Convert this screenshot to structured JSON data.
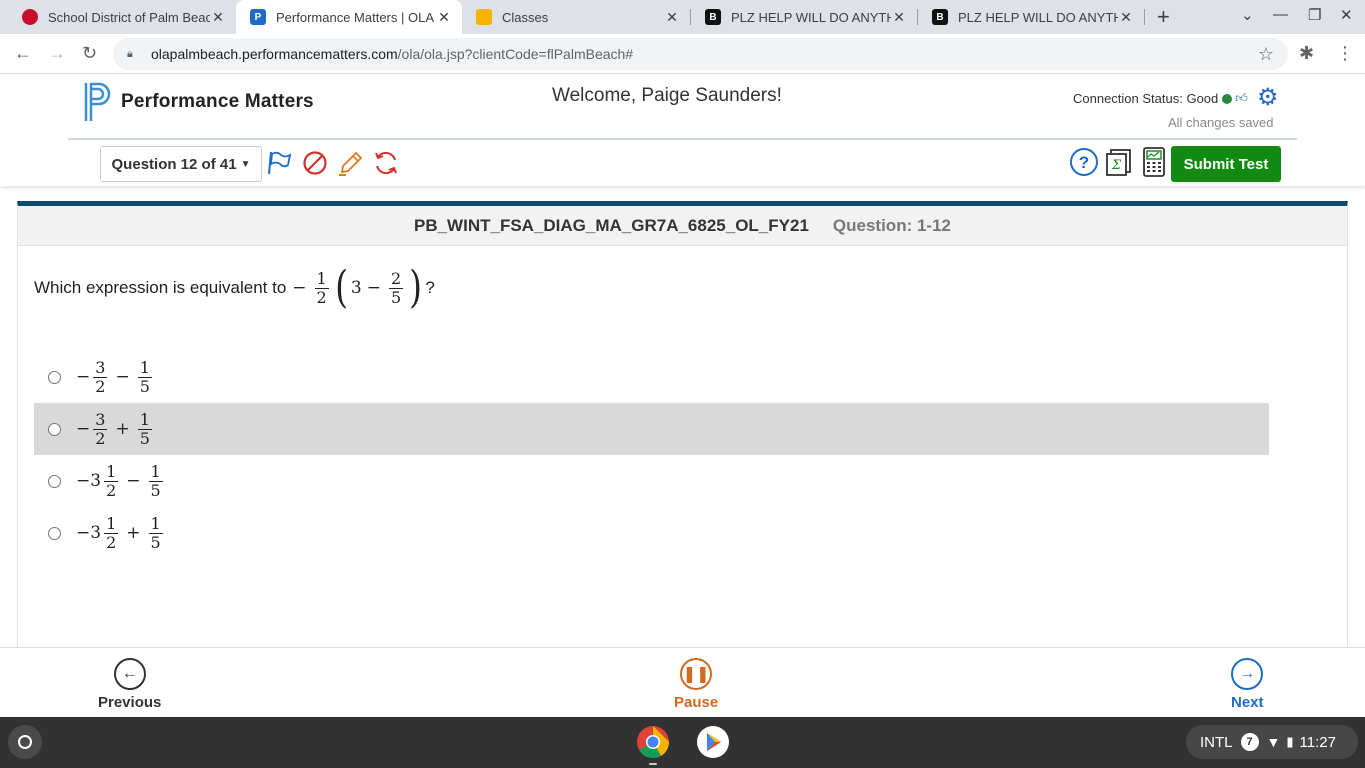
{
  "browser": {
    "tabs": [
      {
        "title": "School District of Palm Beac",
        "favicon": "red-circle-icon",
        "active": false
      },
      {
        "title": "Performance Matters | OLA",
        "favicon": "performance-matters-icon",
        "active": true
      },
      {
        "title": "Classes",
        "favicon": "google-classroom-icon",
        "active": false
      },
      {
        "title": "PLZ HELP WILL DO ANYTHI",
        "favicon": "brainly-icon",
        "active": false
      },
      {
        "title": "PLZ HELP WILL DO ANYTHI",
        "favicon": "brainly-icon",
        "active": false
      }
    ],
    "url_host": "olapalmbeach.performancematters.com",
    "url_path": "/ola/ola.jsp?clientCode=flPalmBeach#"
  },
  "header": {
    "logo_text": "Performance Matters",
    "welcome": "Welcome, Paige Saunders!",
    "connection_label": "Connection Status: Good",
    "saved_status": "All changes saved",
    "question_selector": "Question 12 of 41",
    "submit_label": "Submit Test",
    "accent_color": "#1f6bc6",
    "submit_color": "#128a12"
  },
  "panel": {
    "test_name": "PB_WINT_FSA_DIAG_MA_GR7A_6825_OL_FY21",
    "question_label": "Question: 1-12",
    "stem_text": "Which expression is equivalent to",
    "stem_end": "?",
    "choices": [
      {
        "text": "−3/2 − 1/5"
      },
      {
        "text": "−3/2 + 1/5"
      },
      {
        "text": "−3 1/2 − 1/5"
      },
      {
        "text": "−3 1/2 + 1/5"
      }
    ]
  },
  "footer": {
    "previous": "Previous",
    "pause": "Pause",
    "next": "Next"
  },
  "shelf": {
    "ime": "INTL",
    "notifications": "7",
    "time": "11:27"
  }
}
